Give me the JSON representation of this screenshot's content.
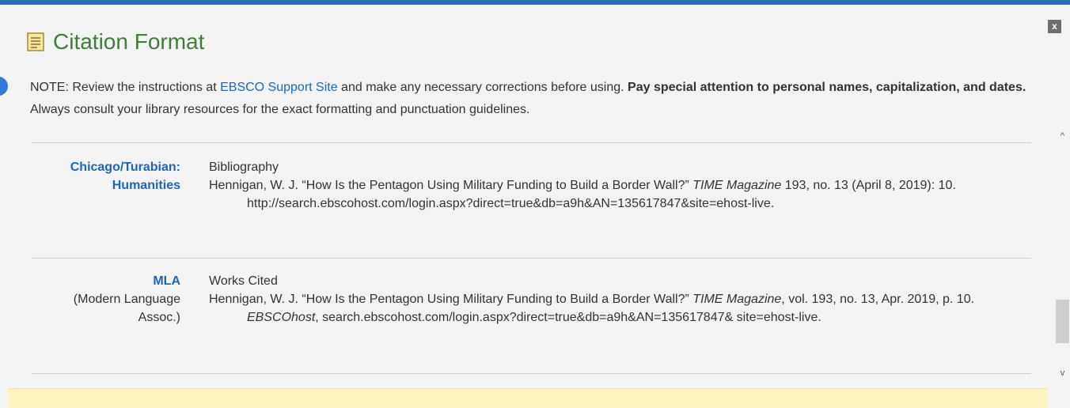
{
  "dialog": {
    "title": "Citation Format",
    "close_label": "x"
  },
  "note": {
    "prefix": "NOTE: Review the instructions at ",
    "link_text": "EBSCO Support Site",
    "middle": " and make any necessary corrections before using. ",
    "bold_text": "Pay special attention to personal names, capitalization, and dates.",
    "suffix": " Always consult your library resources for the exact formatting and punctuation guidelines."
  },
  "citations": [
    {
      "format_line1": "Chicago/Turabian:",
      "format_line2": "Humanities",
      "heading": "Bibliography",
      "ref_part1": "Hennigan, W. J. “How Is the Pentagon Using Military Funding to Build a Border Wall?” ",
      "ref_italic1": "TIME Magazine",
      "ref_part2": " 193, no. 13 (April 8, 2019): 10. http://search.ebscohost.com/login.aspx?direct=true&db=a9h&AN=135617847&site=ehost-live."
    },
    {
      "format_line1": "MLA",
      "format_line2": "(Modern Language",
      "format_line3": "Assoc.)",
      "heading": "Works Cited",
      "ref_part1": "Hennigan, W. J. “How Is the Pentagon Using Military Funding to Build a Border Wall?” ",
      "ref_italic1": "TIME Magazine",
      "ref_part2": ", vol. 193, no. 13, Apr. 2019, p. 10. ",
      "ref_italic2": "EBSCOhost",
      "ref_part3": ", search.ebscohost.com/login.aspx?direct=true&db=a9h&AN=135617847& site=ehost-live."
    }
  ],
  "scrollbar": {
    "up_glyph": "^",
    "down_glyph": "v"
  },
  "colors": {
    "accent_blue": "#2f6db2",
    "title_green": "#3d7f37",
    "link_blue": "#1b69b8",
    "highlight_yellow": "#fcf3c0"
  },
  "icons": {
    "title_icon": "document-icon",
    "info_icon": "info-icon",
    "close_icon": "close-icon"
  }
}
